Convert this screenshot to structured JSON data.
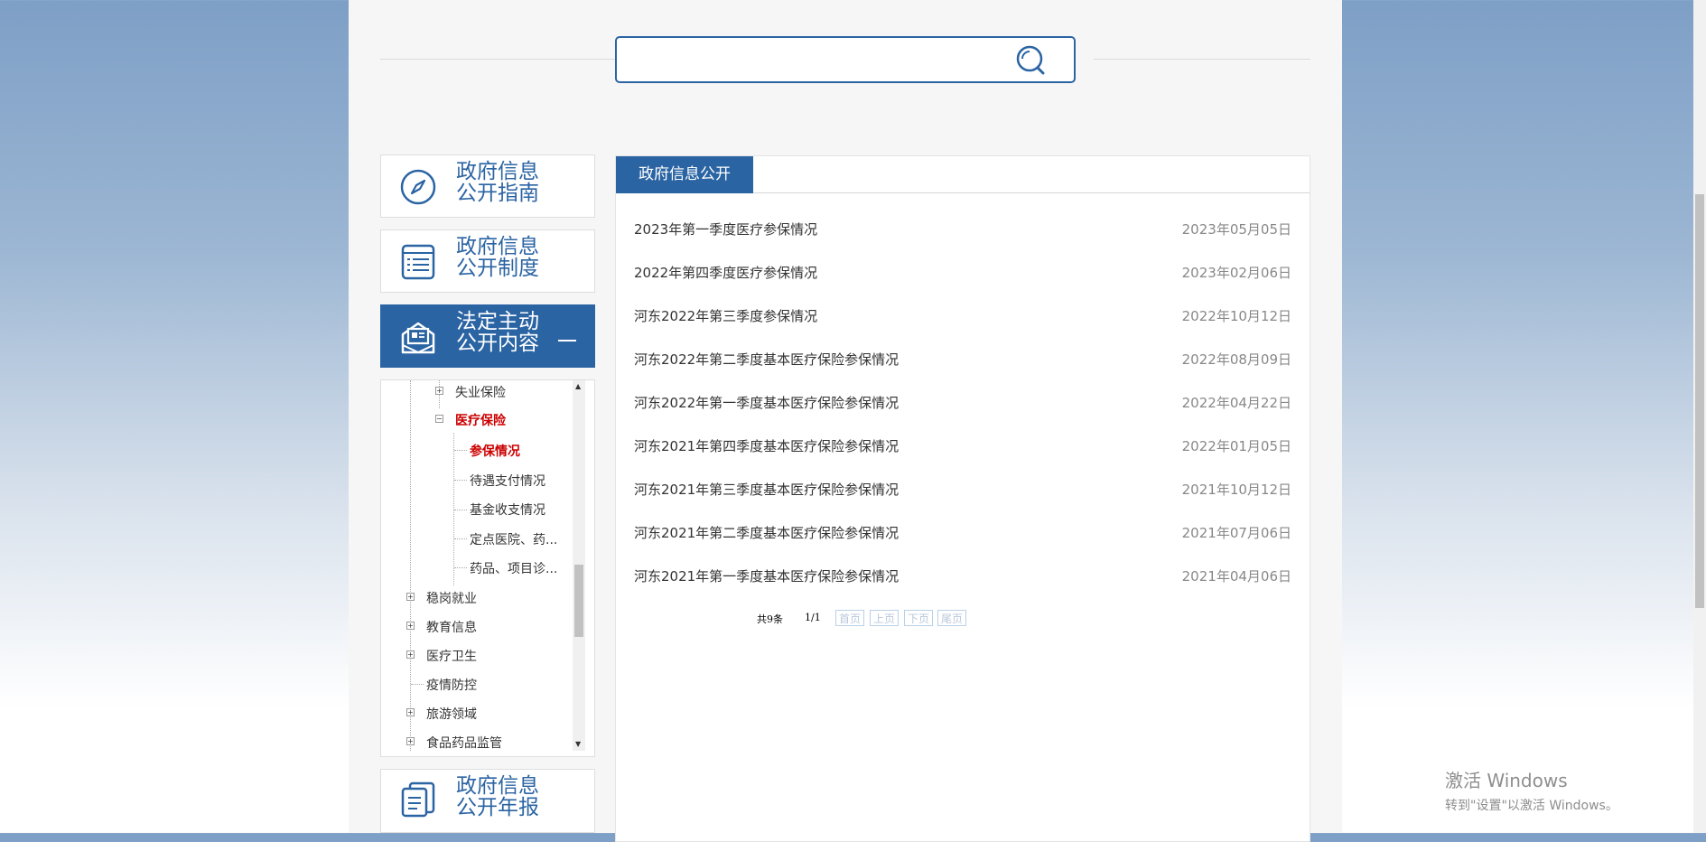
{
  "search": {
    "placeholder": ""
  },
  "sidebar": {
    "cards": [
      {
        "title": "政府信息\n公开指南",
        "icon": "compass-icon"
      },
      {
        "title": "政府信息\n公开制度",
        "icon": "list-document-icon"
      },
      {
        "title": "法定主动\n公开内容",
        "icon": "envelope-news-icon",
        "expanded": true
      },
      {
        "title": "政府信息\n公开年报",
        "icon": "report-document-icon"
      }
    ],
    "tree": [
      {
        "label": "失业保险"
      },
      {
        "label": "医疗保险",
        "active": true
      },
      {
        "label": "参保情况",
        "active": true
      },
      {
        "label": "待遇支付情况"
      },
      {
        "label": "基金收支情况"
      },
      {
        "label": "定点医院、药..."
      },
      {
        "label": "药品、项目诊..."
      },
      {
        "label": "稳岗就业"
      },
      {
        "label": "教育信息"
      },
      {
        "label": "医疗卫生"
      },
      {
        "label": "疫情防控"
      },
      {
        "label": "旅游领域"
      },
      {
        "label": "食品药品监管"
      }
    ]
  },
  "main": {
    "tab_label": "政府信息公开",
    "items": [
      {
        "title": "2023年第一季度医疗参保情况",
        "date": "2023年05月05日"
      },
      {
        "title": "2022年第四季度医疗参保情况",
        "date": "2023年02月06日"
      },
      {
        "title": "河东2022年第三季度参保情况",
        "date": "2022年10月12日"
      },
      {
        "title": "河东2022年第二季度基本医疗保险参保情况",
        "date": "2022年08月09日"
      },
      {
        "title": "河东2022年第一季度基本医疗保险参保情况",
        "date": "2022年04月22日"
      },
      {
        "title": "河东2021年第四季度基本医疗保险参保情况",
        "date": "2022年01月05日"
      },
      {
        "title": "河东2021年第三季度基本医疗保险参保情况",
        "date": "2021年10月12日"
      },
      {
        "title": "河东2021年第二季度基本医疗保险参保情况",
        "date": "2021年07月06日"
      },
      {
        "title": "河东2021年第一季度基本医疗保险参保情况",
        "date": "2021年04月06日"
      }
    ],
    "pager": {
      "total": "共9条",
      "page": "1/1",
      "first": "首页",
      "prev": "上页",
      "next": "下页",
      "last": "尾页"
    }
  },
  "watermark": {
    "line1": "激活 Windows",
    "line2": "转到\"设置\"以激活 Windows。"
  },
  "colors": {
    "brand": "#2b64a3",
    "active_text": "#cc0000"
  }
}
